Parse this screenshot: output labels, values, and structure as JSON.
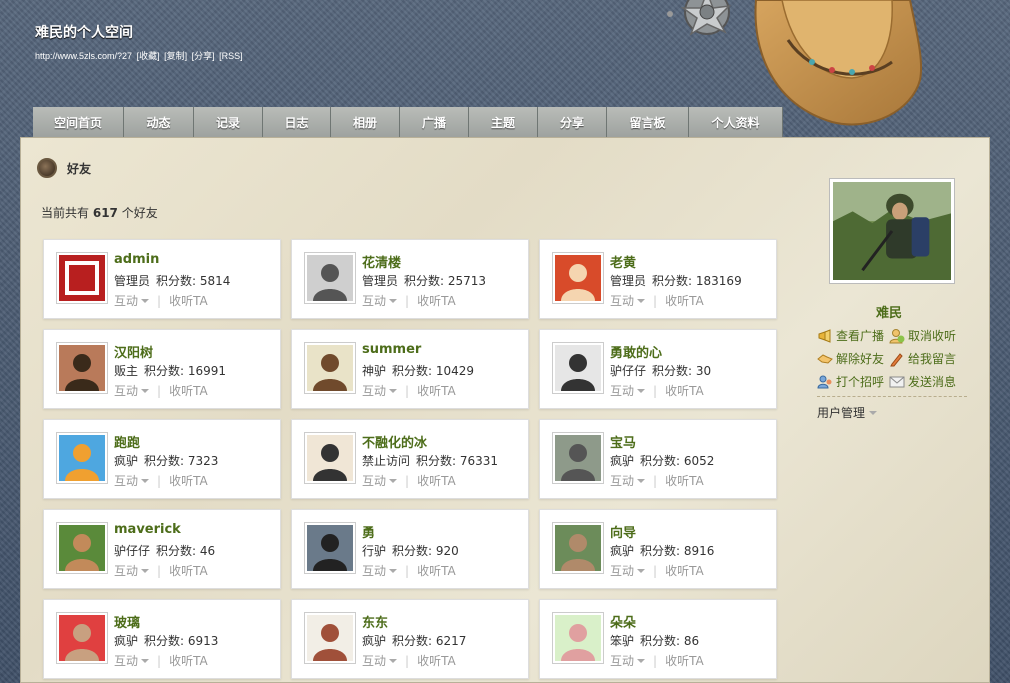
{
  "header": {
    "title": "难民的个人空间",
    "url": "http://www.5zls.com/?27",
    "links": [
      "[收藏]",
      "[复制]",
      "[分享]",
      "[RSS]"
    ]
  },
  "nav": {
    "items": [
      {
        "label": "空间首页",
        "width": 91
      },
      {
        "label": "动态",
        "width": 70
      },
      {
        "label": "记录",
        "width": 69
      },
      {
        "label": "日志",
        "width": 68
      },
      {
        "label": "相册",
        "width": 69
      },
      {
        "label": "广播",
        "width": 69
      },
      {
        "label": "主题",
        "width": 69
      },
      {
        "label": "分享",
        "width": 69
      },
      {
        "label": "留言板",
        "width": 82
      },
      {
        "label": "个人资料",
        "width": 94
      }
    ]
  },
  "section": {
    "title": "好友",
    "count_prefix": "当前共有",
    "count": "617",
    "count_suffix": "个好友",
    "score_label": "积分数:"
  },
  "friends": [
    {
      "name": "admin",
      "level": "管理员",
      "score": "5814"
    },
    {
      "name": "花清楼",
      "level": "管理员",
      "score": "25713"
    },
    {
      "name": "老黄",
      "level": "管理员",
      "score": "183169"
    },
    {
      "name": "汉阳树",
      "level": "贩主",
      "score": "16991"
    },
    {
      "name": "summer",
      "level": "神驴",
      "score": "10429"
    },
    {
      "name": "勇敢的心",
      "level": "驴仔仔",
      "score": "30"
    },
    {
      "name": "跑跑",
      "level": "疯驴",
      "score": "7323"
    },
    {
      "name": "不融化的冰",
      "level": "禁止访问",
      "score": "76331"
    },
    {
      "name": "宝马",
      "level": "疯驴",
      "score": "6052"
    },
    {
      "name": "maverick",
      "level": "驴仔仔",
      "score": "46"
    },
    {
      "name": "勇",
      "level": "行驴",
      "score": "920"
    },
    {
      "name": "向导",
      "level": "疯驴",
      "score": "8916"
    },
    {
      "name": "玻璃",
      "level": "疯驴",
      "score": "6913"
    },
    {
      "name": "东东",
      "level": "疯驴",
      "score": "6217"
    },
    {
      "name": "朵朵",
      "level": "笨驴",
      "score": "86"
    }
  ],
  "card_actions": {
    "interact": "互动",
    "follow": "收听TA",
    "separator": "|"
  },
  "sidebar": {
    "profile_name": "难民",
    "actions": [
      [
        "查看广播",
        "取消收听"
      ],
      [
        "解除好友",
        "给我留言"
      ],
      [
        "打个招呼",
        "发送消息"
      ]
    ],
    "user_mgmt": "用户管理"
  },
  "colors": {
    "accent": "#4d6d1a",
    "nav_bg": "#a9aca8",
    "panel_bg": "#e6e0cb"
  }
}
